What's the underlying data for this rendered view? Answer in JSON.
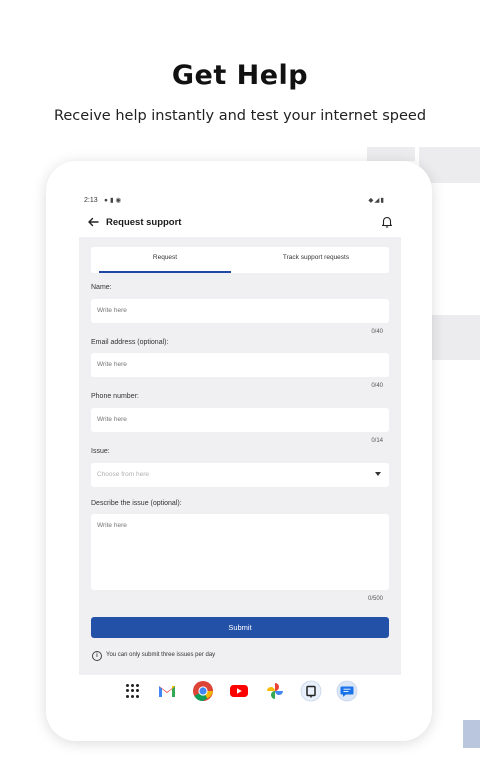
{
  "promo": {
    "headline": "Get Help",
    "subheadline": "Receive help instantly and test your internet speed"
  },
  "statusbar": {
    "time": "2:13",
    "left_icons": [
      "mic-icon",
      "sim-icon",
      "shield-icon"
    ],
    "right_icons": [
      "wifi-icon",
      "signal-icon",
      "battery-icon"
    ]
  },
  "appbar": {
    "title": "Request support",
    "back_icon": "arrow-left-icon",
    "notification_icon": "bell-icon"
  },
  "tabs": {
    "request": "Request",
    "track": "Track support requests",
    "active": "Request"
  },
  "form": {
    "name": {
      "label": "Name:",
      "placeholder": "Write here",
      "counter": "0/40"
    },
    "email": {
      "label": "Email address (optional):",
      "placeholder": "Write here",
      "counter": "0/40"
    },
    "phone": {
      "label": "Phone number:",
      "placeholder": "Write here",
      "counter": "0/14"
    },
    "issue": {
      "label": "Issue:",
      "placeholder": "Choose from here"
    },
    "description": {
      "label": "Describe the issue (optional):",
      "placeholder": "Write here",
      "counter": "0/500"
    },
    "submit_label": "Submit",
    "info_note": "You can only submit three issues per day"
  },
  "dock": {
    "apps": [
      "apps-grid-icon",
      "gmail-icon",
      "chrome-icon",
      "youtube-icon",
      "photos-icon",
      "app-icon",
      "messages-icon"
    ]
  },
  "colors": {
    "accent": "#2451a8",
    "tab_underline": "#2148a4",
    "screen_background": "#f0f0f2"
  }
}
